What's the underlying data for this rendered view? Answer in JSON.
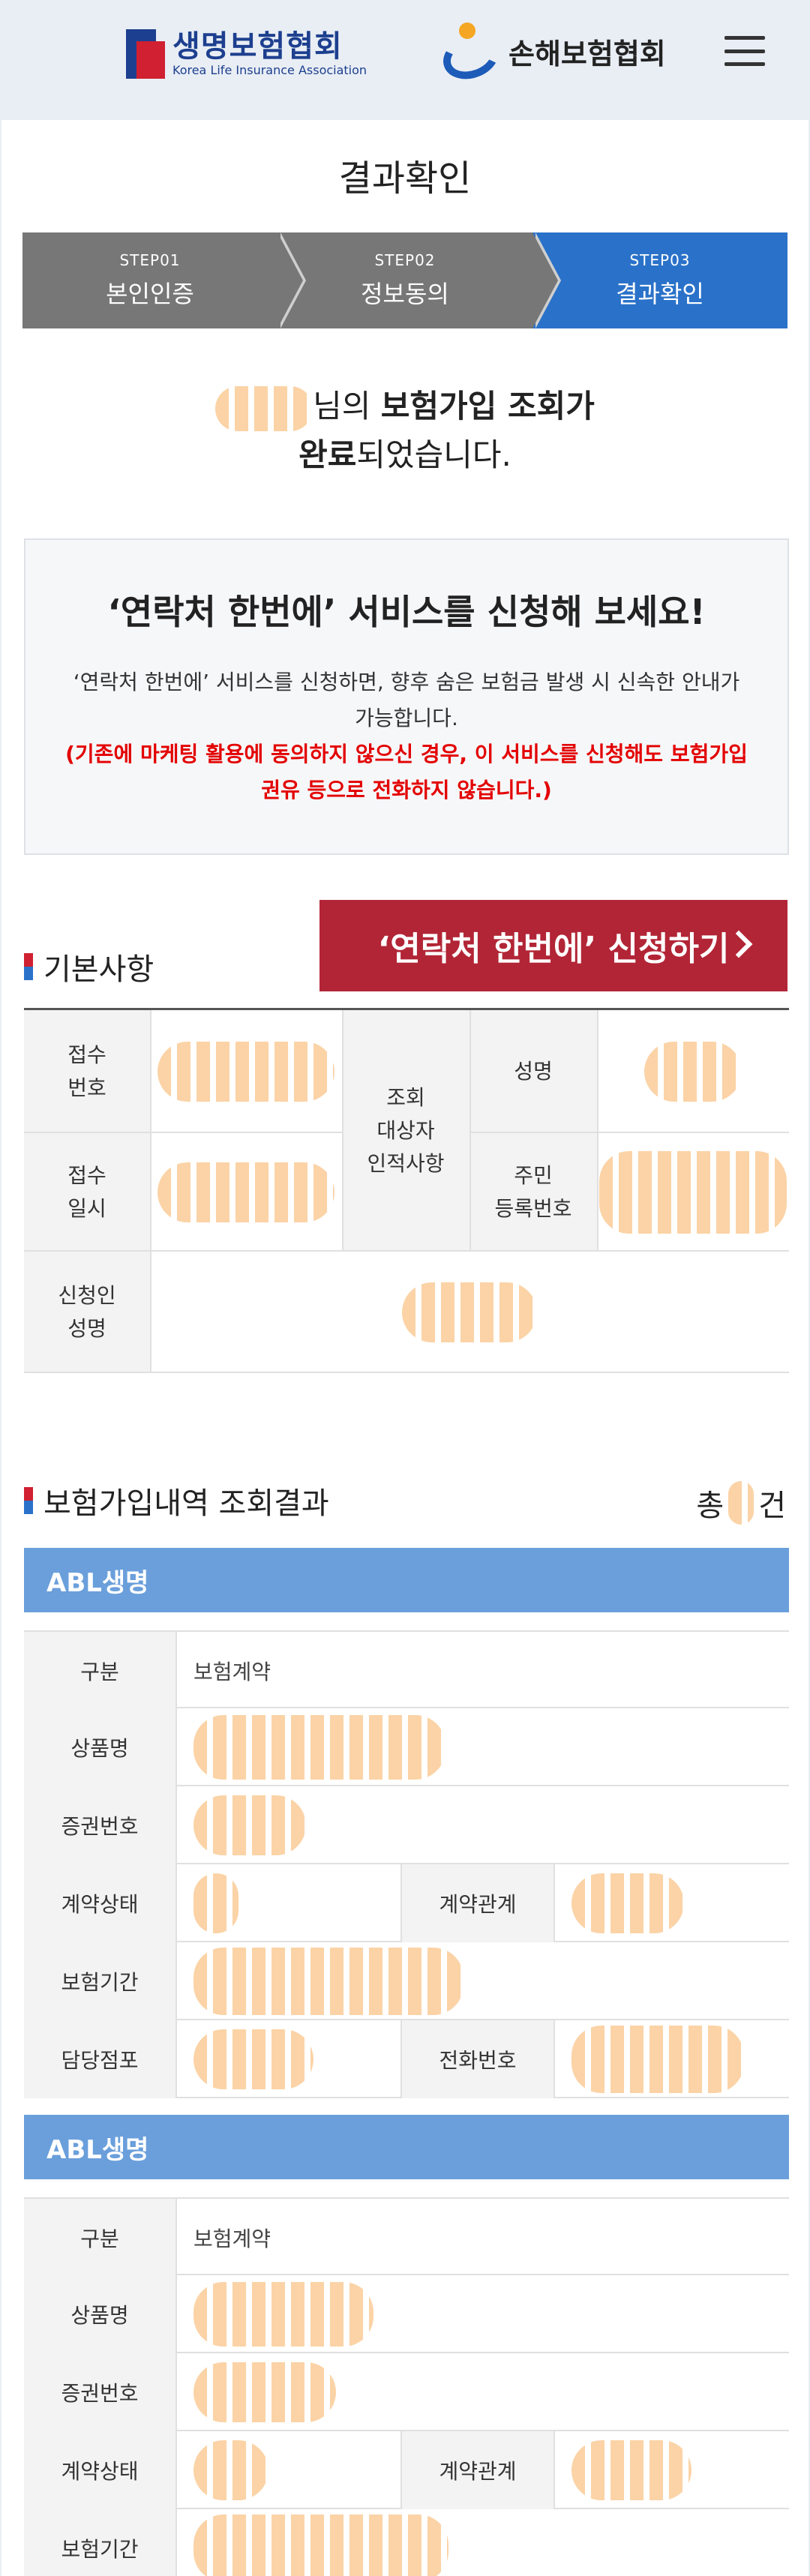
{
  "header": {
    "life_logo_ko": "생명보험협회",
    "life_logo_en": "Korea Life Insurance Association",
    "nonlife_logo_ko": "손해보험협회",
    "menu_icon": "hamburger-icon"
  },
  "page": {
    "title": "결과확인"
  },
  "steps": [
    {
      "no": "STEP01",
      "label": "본인인증"
    },
    {
      "no": "STEP02",
      "label": "정보동의"
    },
    {
      "no": "STEP03",
      "label": "결과확인"
    }
  ],
  "done_message": {
    "suffix1": "님의 ",
    "strong1": "보험가입 조회가",
    "strong2": "완료",
    "suffix2": "되었습니다."
  },
  "notice": {
    "heading": "‘연락처 한번에’ 서비스를 신청해 보세요!",
    "body": "‘연락처 한번에’ 서비스를 신청하면, 향후 숨은 보험금 발생 시 신속한 안내가 가능합니다.",
    "warning": "(기존에 마케팅 활용에 동의하지 않으신 경우, 이 서비스를 신청해도 보험가입 권유 등으로 전화하지 않습니다.)"
  },
  "basic": {
    "title": "기본사항",
    "apply_button": "‘연락처 한번에’ 신청하기",
    "receipt_no": "접수\n번호",
    "receipt_date": "접수\n일시",
    "person_info": "조회\n대상자\n인적사항",
    "name": "성명",
    "rrn": "주민\n등록번호",
    "applicant_name": "신청인\n성명"
  },
  "results": {
    "title": "보험가입내역 조회결과",
    "total_prefix": "총",
    "total_suffix": "건",
    "labels": {
      "type": "구분",
      "product": "상품명",
      "policy_no": "증권번호",
      "status": "계약상태",
      "relation": "계약관계",
      "period": "보험기간",
      "branch": "담당점포",
      "phone": "전화번호"
    },
    "items": [
      {
        "company": "ABL생명",
        "type_value": "보험계약"
      },
      {
        "company": "ABL생명",
        "type_value": "보험계약"
      }
    ]
  }
}
